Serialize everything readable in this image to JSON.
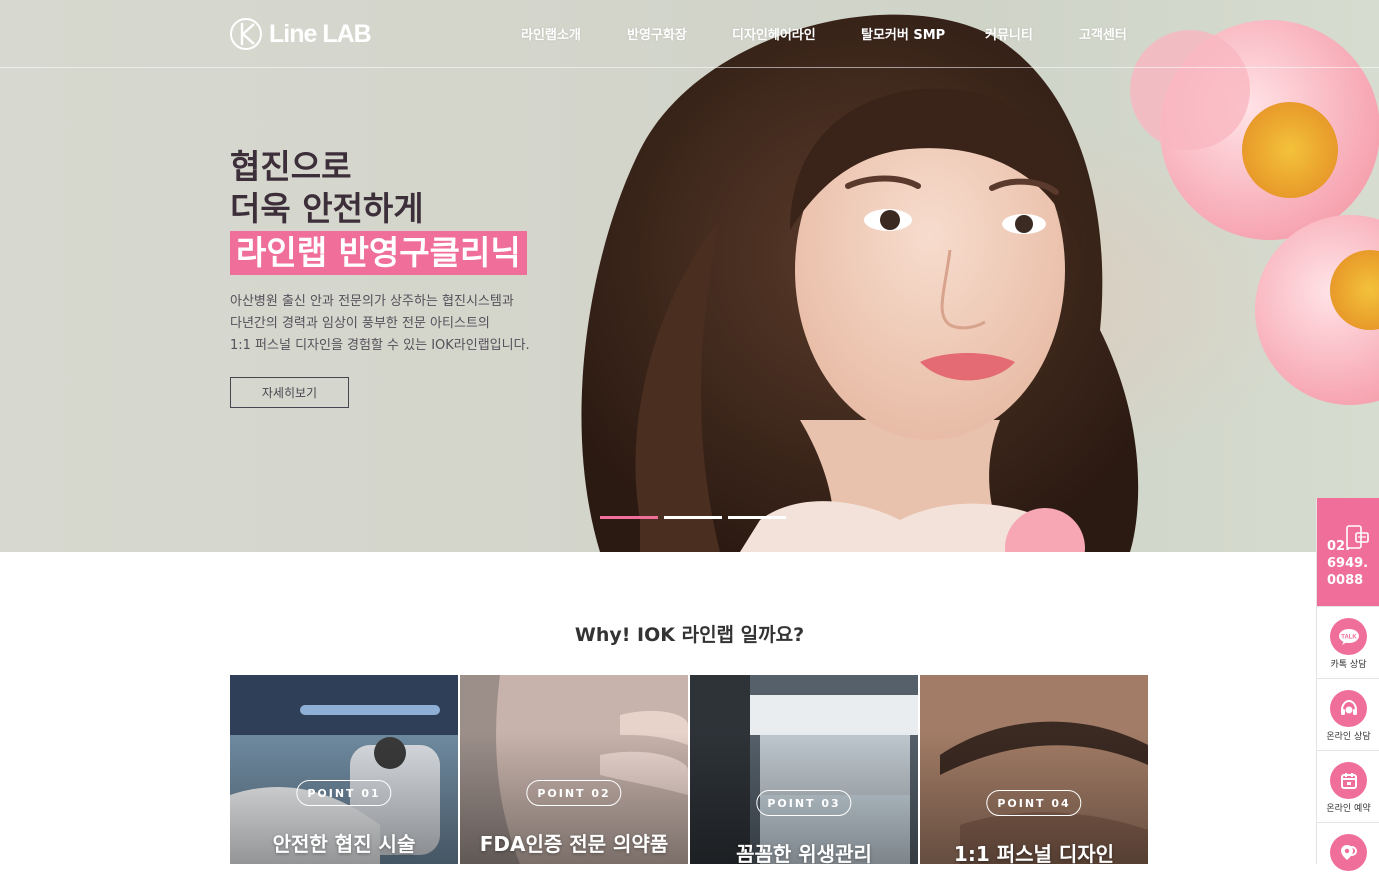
{
  "brand": {
    "logo_text": "Line LAB"
  },
  "nav": {
    "items": [
      "라인랩소개",
      "반영구화장",
      "디자인헤어라인",
      "탈모커버 SMP",
      "커뮤니티",
      "고객센터"
    ]
  },
  "hero": {
    "headline_line1": "협진으로",
    "headline_line2": "더욱 안전하게",
    "headline_highlight": "라인랩 반영구클리닉",
    "description": [
      "아산병원 출신 안과 전문의가 상주하는 협진시스템과",
      "다년간의 경력과 임상이 풍부한 전문 아티스트의",
      "1:1 퍼스널 디자인을 경험할 수 있는 IOK라인랩입니다."
    ],
    "more_button": "자세히보기",
    "slides_count": 3,
    "active_slide": 1
  },
  "why": {
    "title": "Why! IOK 라인랩 일까요?",
    "cards": [
      {
        "point": "POINT 01",
        "title": "안전한 협진 시술"
      },
      {
        "point": "POINT 02",
        "title": "FDA인증 전문 의약품"
      },
      {
        "point": "POINT 03",
        "title": "꼼꼼한 위생관리"
      },
      {
        "point": "POINT 04",
        "title": "1:1 퍼스널 디자인"
      }
    ]
  },
  "quickbar": {
    "phone_line1": "02.",
    "phone_line2": "6949.",
    "phone_line3": "0088",
    "items": [
      {
        "label": "카톡 상담",
        "icon": "kakao-talk-icon"
      },
      {
        "label": "온라인 상담",
        "icon": "headset-icon"
      },
      {
        "label": "온라인 예약",
        "icon": "calendar-icon"
      },
      {
        "label": "",
        "icon": "location-search-icon"
      }
    ]
  },
  "colors": {
    "accent": "#ef6e9a",
    "headline": "#3d2f3a"
  }
}
